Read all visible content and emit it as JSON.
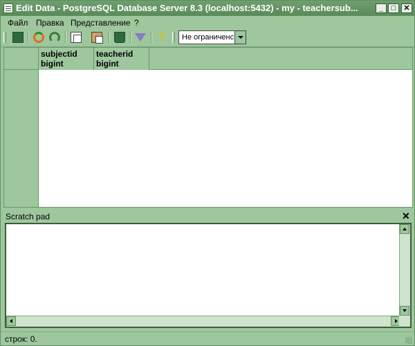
{
  "window": {
    "title": "Edit Data - PostgreSQL Database Server 8.3 (localhost:5432) - my - teachersub..."
  },
  "title_buttons": {
    "minimize": "_",
    "maximize": "□",
    "close": "✕"
  },
  "menu": {
    "items": [
      {
        "label": "Файл"
      },
      {
        "label": "Правка"
      },
      {
        "label": "Представление"
      },
      {
        "label": "?"
      }
    ]
  },
  "toolbar": {
    "limit_value": "Не ограниченс",
    "icons": [
      "save-icon",
      "refresh-icon",
      "undo-icon",
      "copy-icon",
      "paste-icon",
      "delete-icon",
      "filter-icon",
      "help-icon"
    ]
  },
  "grid": {
    "columns": [
      {
        "name": "subjectid",
        "type": "bigint"
      },
      {
        "name": "teacherid",
        "type": "bigint"
      }
    ]
  },
  "scratch": {
    "label": "Scratch pad",
    "close": "✕",
    "content": ""
  },
  "status": {
    "text": "строк: 0."
  },
  "colors": {
    "theme_green": "#9ec79e",
    "title_bar": "#5a8a5a"
  }
}
